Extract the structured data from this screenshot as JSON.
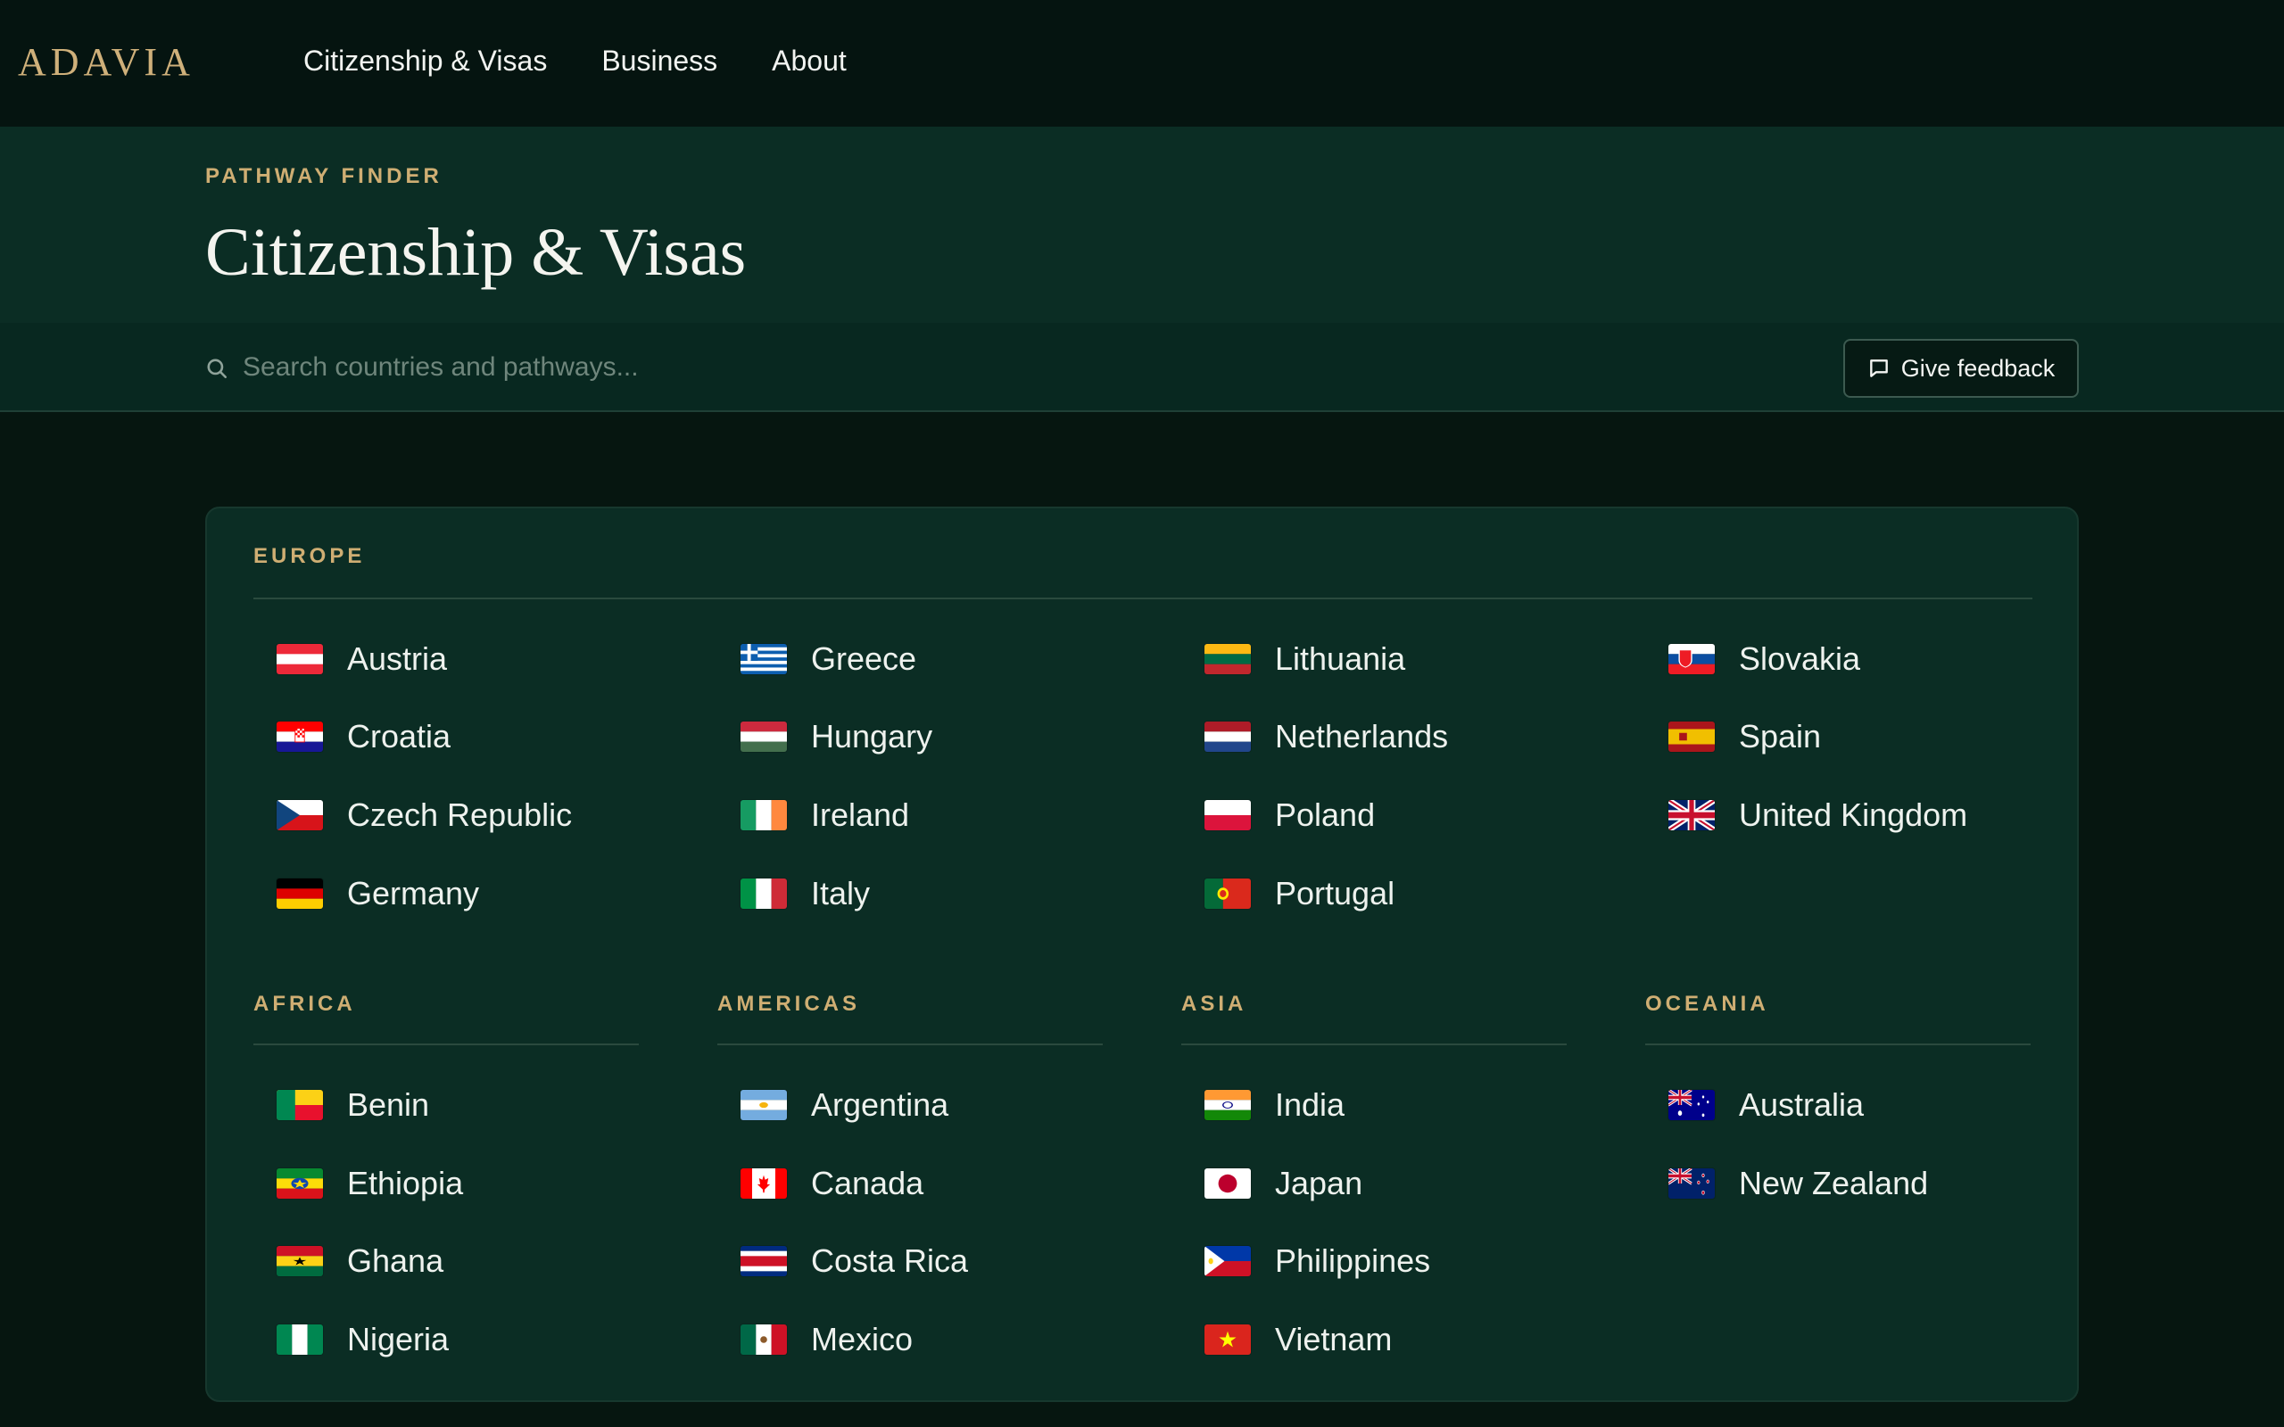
{
  "nav": {
    "logo": "ADAVIA",
    "links": [
      "Citizenship & Visas",
      "Business",
      "About"
    ]
  },
  "header": {
    "eyebrow": "PATHWAY FINDER",
    "title": "Citizenship & Visas"
  },
  "search": {
    "placeholder": "Search countries and pathways...",
    "value": "",
    "icon": "search-icon",
    "feedback_label": "Give feedback",
    "feedback_icon": "message-square-icon"
  },
  "colors": {
    "accent_gold": "#cfae73",
    "background": "#061610",
    "panel": "#0b2d24"
  },
  "regions": {
    "europe": {
      "title": "EUROPE",
      "columns": [
        [
          "Austria",
          "Croatia",
          "Czech Republic",
          "Germany"
        ],
        [
          "Greece",
          "Hungary",
          "Ireland",
          "Italy"
        ],
        [
          "Lithuania",
          "Netherlands",
          "Poland",
          "Portugal"
        ],
        [
          "Slovakia",
          "Spain",
          "United Kingdom"
        ]
      ]
    },
    "africa": {
      "title": "AFRICA",
      "countries": [
        "Benin",
        "Ethiopia",
        "Ghana",
        "Nigeria"
      ]
    },
    "americas": {
      "title": "AMERICAS",
      "countries": [
        "Argentina",
        "Canada",
        "Costa Rica",
        "Mexico"
      ]
    },
    "asia": {
      "title": "ASIA",
      "countries": [
        "India",
        "Japan",
        "Philippines",
        "Vietnam"
      ]
    },
    "oceania": {
      "title": "OCEANIA",
      "countries": [
        "Australia",
        "New Zealand"
      ]
    }
  }
}
